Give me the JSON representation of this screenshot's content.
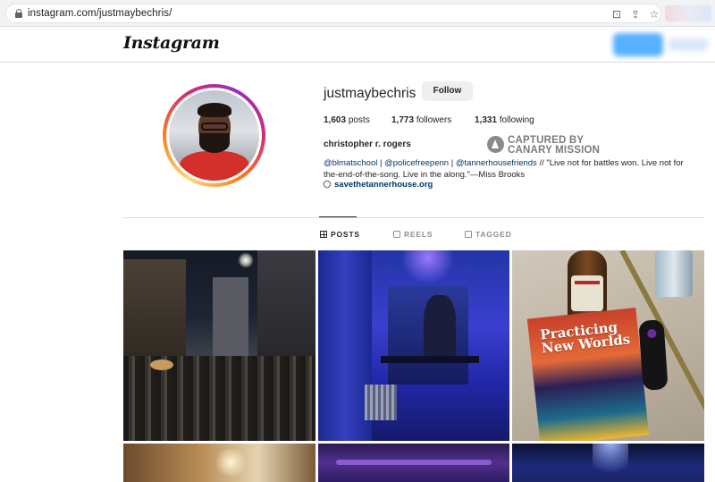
{
  "browser": {
    "url": "instagram.com/justmaybechris/",
    "icons": [
      "lock-icon",
      "install-icon",
      "share-icon",
      "star-icon"
    ]
  },
  "header": {
    "logo": "Instagram"
  },
  "profile": {
    "username": "justmaybechris",
    "follow_label": "Follow",
    "posts_count": "1,603",
    "posts_label": "posts",
    "followers_count": "1,773",
    "followers_label": "followers",
    "following_count": "1,331",
    "following_label": "following",
    "full_name": "christopher r. rogers",
    "bio_mention_1": "@blmatschool",
    "bio_sep_1": " | ",
    "bio_mention_2": "@policefreepenn",
    "bio_sep_2": " | ",
    "bio_mention_3": "@tannerhousefriends",
    "bio_text": " // \"Live not for battles won. Live not for the-end-of-the-song. Live in the along.\"—Miss Brooks",
    "link": "savethetannerhouse.org"
  },
  "watermark": {
    "line1": "CAPTURED BY",
    "line2": "CANARY MISSION"
  },
  "tabs": [
    {
      "label": "POSTS",
      "active": true,
      "icon": "grid-icon"
    },
    {
      "label": "REELS",
      "active": false,
      "icon": "reels-icon"
    },
    {
      "label": "TAGGED",
      "active": false,
      "icon": "tagged-icon"
    }
  ],
  "posts": {
    "book_title": "Practicing New Worlds"
  },
  "colors": {
    "link": "#00376b",
    "muted": "#8e8e8e",
    "follow_bg": "#efefef"
  }
}
